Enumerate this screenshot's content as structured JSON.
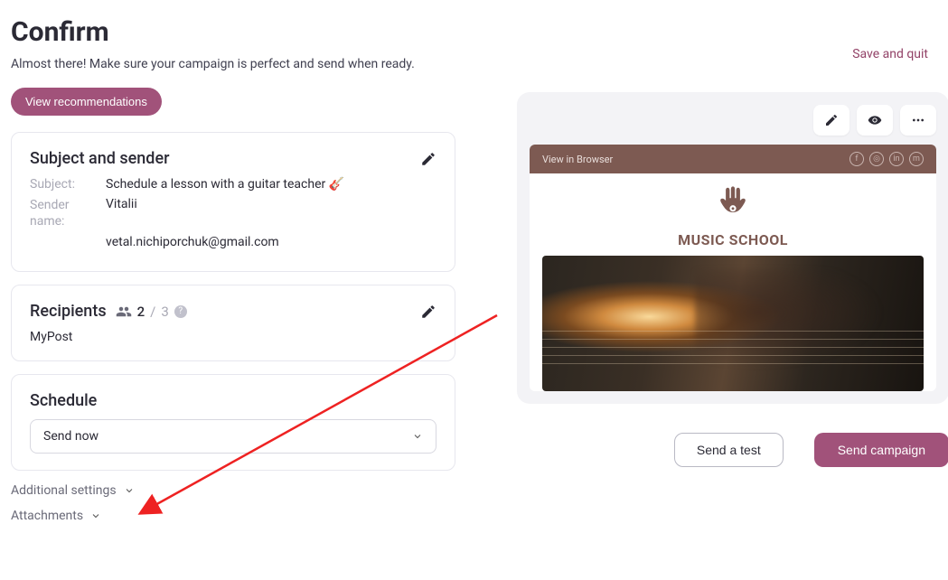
{
  "header": {
    "title": "Confirm",
    "subtitle": "Almost there! Make sure your campaign is perfect and send when ready.",
    "view_recommendations": "View recommendations",
    "save_quit": "Save and quit"
  },
  "subject_sender": {
    "card_title": "Subject and sender",
    "subject_label": "Subject:",
    "subject_value": "Schedule a lesson with a guitar teacher 🎸",
    "sender_name_label": "Sender name:",
    "sender_name_value": "Vitalii",
    "sender_email_value": "vetal.nichiporchuk@gmail.com"
  },
  "recipients": {
    "card_title": "Recipients",
    "selected_count": "2",
    "total_count": "3",
    "list_name": "MyPost"
  },
  "schedule": {
    "card_title": "Schedule",
    "selected": "Send now"
  },
  "collapsibles": {
    "additional_settings": "Additional settings",
    "attachments": "Attachments"
  },
  "preview": {
    "view_in_browser": "View in Browser",
    "brand": "MUSIC SCHOOL"
  },
  "actions": {
    "send_test": "Send a test",
    "send_campaign": "Send campaign"
  }
}
